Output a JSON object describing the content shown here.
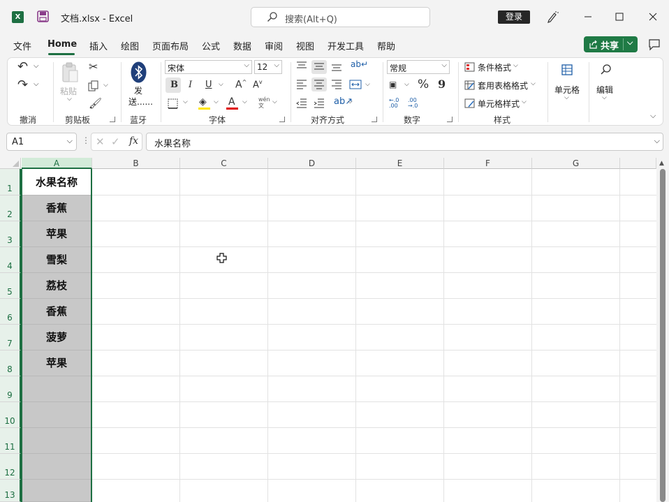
{
  "titlebar": {
    "file_title": "文档.xlsx  -  Excel",
    "search_placeholder": "搜索(Alt+Q)",
    "login_label": "登录",
    "app_icon_letter": "X"
  },
  "menu": {
    "tabs": [
      "文件",
      "Home",
      "插入",
      "绘图",
      "页面布局",
      "公式",
      "数据",
      "审阅",
      "视图",
      "开发工具",
      "帮助"
    ],
    "active_tab": "Home",
    "share_label": "共享"
  },
  "ribbon": {
    "undo_group": "撤消",
    "clipboard": {
      "paste_label": "粘贴",
      "group": "剪贴板"
    },
    "bluetooth": {
      "label_line1": "发",
      "label_line2": "送......",
      "group": "蓝牙"
    },
    "font": {
      "name": "宋体",
      "size": "12",
      "group": "字体",
      "bold": "B",
      "italic": "I",
      "underline": "U",
      "phonetic": "wén"
    },
    "alignment": {
      "group": "对齐方式"
    },
    "number": {
      "format": "常规",
      "group": "数字",
      "percent": "%",
      "comma": "9"
    },
    "styles": {
      "conditional": "条件格式",
      "table": "套用表格格式",
      "cell_style": "单元格样式",
      "group": "样式"
    },
    "cells": {
      "label": "单元格"
    },
    "editing": {
      "label": "编辑"
    }
  },
  "formula_bar": {
    "name_box": "A1",
    "fx": "fx",
    "content": "水果名称"
  },
  "sheet": {
    "columns": [
      "A",
      "B",
      "C",
      "D",
      "E",
      "F",
      "G"
    ],
    "rows": [
      "1",
      "2",
      "3",
      "4",
      "5",
      "6",
      "7",
      "8",
      "9",
      "10",
      "11",
      "12",
      "13"
    ],
    "colA_values": [
      "水果名称",
      "香蕉",
      "苹果",
      "雪梨",
      "荔枝",
      "香蕉",
      "菠萝",
      "苹果"
    ]
  },
  "colors": {
    "accent": "#1d6f42",
    "selection_fill": "#c8c8c8"
  }
}
